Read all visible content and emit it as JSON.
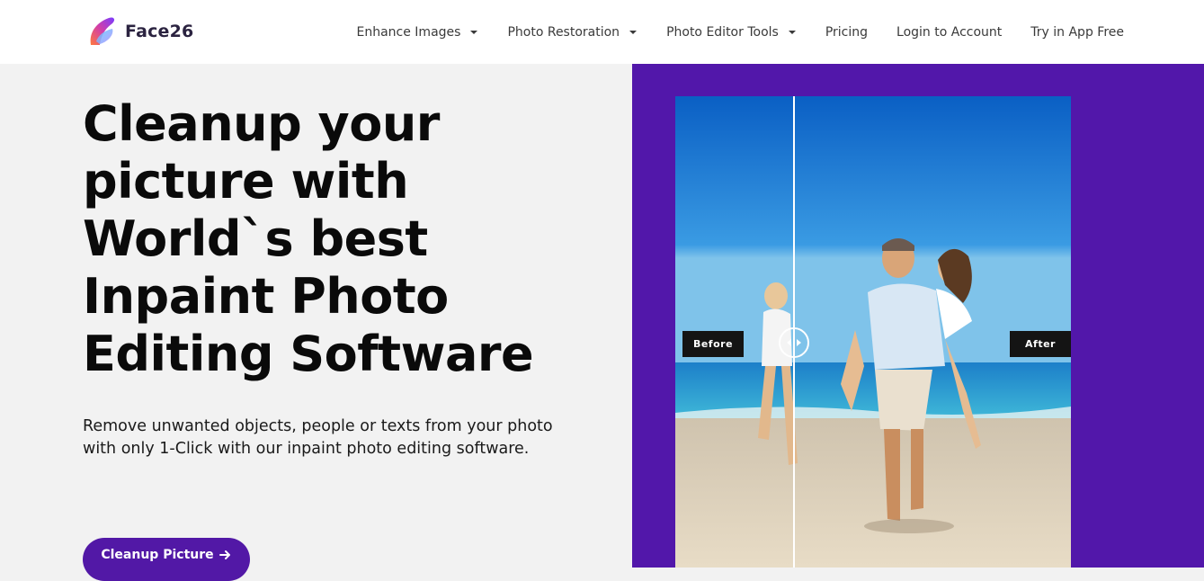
{
  "brand": {
    "name": "Face26",
    "colors": {
      "primary": "#5218a6",
      "panel": "#5217aa"
    }
  },
  "nav": {
    "items": [
      {
        "label": "Enhance Images",
        "has_dropdown": true
      },
      {
        "label": "Photo Restoration",
        "has_dropdown": true
      },
      {
        "label": "Photo Editor Tools",
        "has_dropdown": true
      },
      {
        "label": "Pricing",
        "has_dropdown": false
      },
      {
        "label": "Login to Account",
        "has_dropdown": false
      },
      {
        "label": "Try in App Free",
        "has_dropdown": false
      }
    ]
  },
  "hero": {
    "title_lines": [
      "Cleanup your",
      "picture with",
      "World`s best",
      "Inpaint Photo",
      "Editing Software"
    ],
    "subtitle": "Remove unwanted objects, people or texts from your photo with only 1-Click with our inpaint photo editing software.",
    "cta_label": "Cleanup Picture"
  },
  "comparison": {
    "before_label": "Before",
    "after_label": "After",
    "icons": [
      "caret-down-icon",
      "arrow-right-icon",
      "slider-handle-icon"
    ]
  }
}
